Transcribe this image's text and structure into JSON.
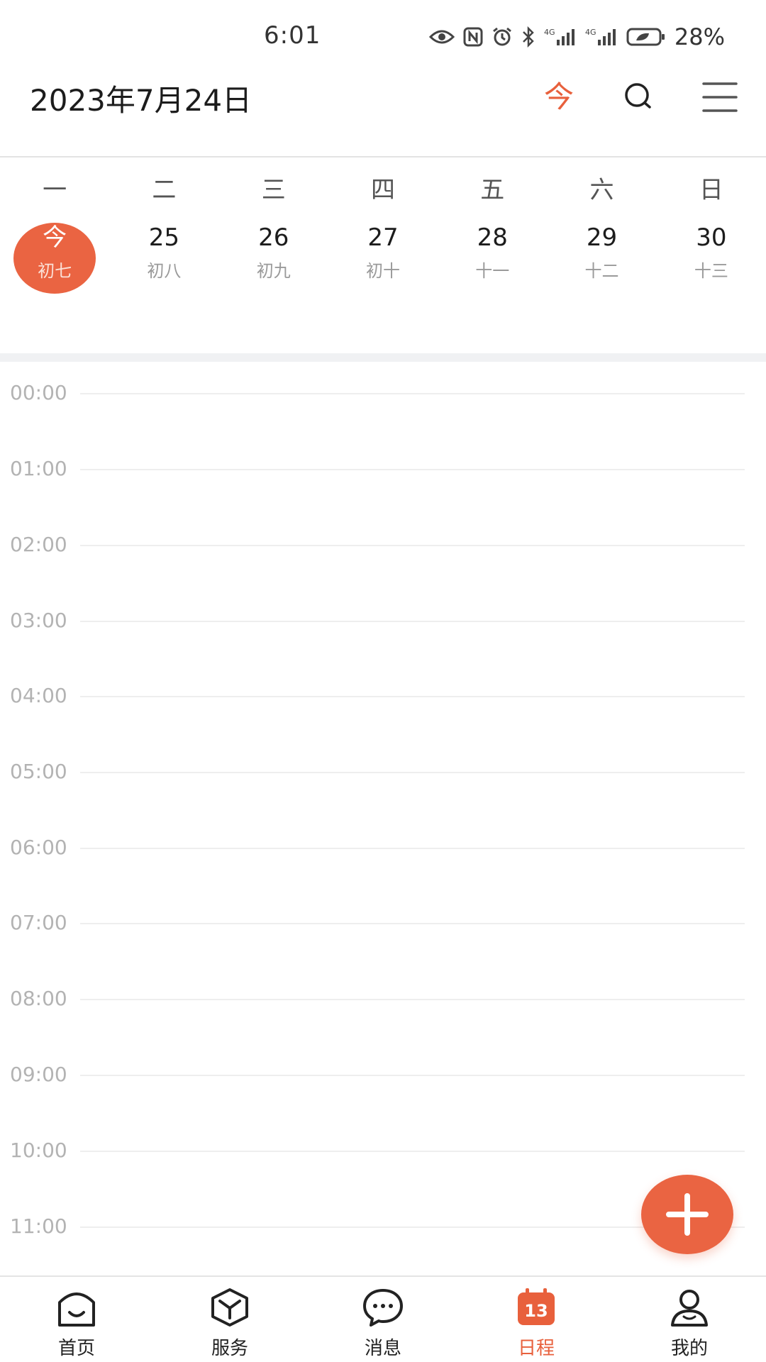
{
  "status_bar": {
    "time": "6:01",
    "battery_percent": "28%",
    "icons": [
      "eye-icon",
      "nfc-icon",
      "alarm-icon",
      "bluetooth-icon",
      "signal-4g-icon",
      "signal-4g-icon-2",
      "battery-icon"
    ]
  },
  "header": {
    "title": "2023年7月24日",
    "today_label": "今",
    "accent_color": "#e8603c"
  },
  "week": {
    "weekdays": [
      "一",
      "二",
      "三",
      "四",
      "五",
      "六",
      "日"
    ],
    "dates": [
      {
        "num": "今",
        "lunar": "初七",
        "active": true
      },
      {
        "num": "25",
        "lunar": "初八"
      },
      {
        "num": "26",
        "lunar": "初九"
      },
      {
        "num": "27",
        "lunar": "初十"
      },
      {
        "num": "28",
        "lunar": "十一"
      },
      {
        "num": "29",
        "lunar": "十二"
      },
      {
        "num": "30",
        "lunar": "十三"
      }
    ]
  },
  "timeline": {
    "hours": [
      "00:00",
      "01:00",
      "02:00",
      "03:00",
      "04:00",
      "05:00",
      "06:00",
      "07:00",
      "08:00",
      "09:00",
      "10:00",
      "11:00"
    ]
  },
  "bottom_nav": {
    "items": [
      {
        "label": "首页",
        "icon": "home-icon"
      },
      {
        "label": "服务",
        "icon": "cube-icon"
      },
      {
        "label": "消息",
        "icon": "chat-bubble-icon"
      },
      {
        "label": "日程",
        "icon": "calendar-icon",
        "active": true,
        "calendar_day": "13"
      },
      {
        "label": "我的",
        "icon": "user-icon"
      }
    ]
  }
}
